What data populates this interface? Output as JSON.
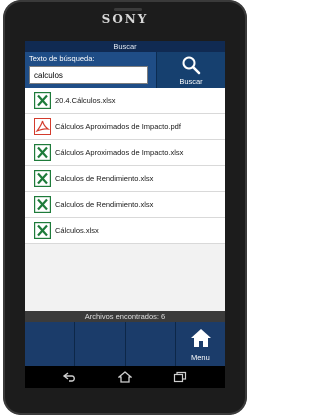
{
  "device": {
    "brand": "SONY"
  },
  "app": {
    "title": "Buscar",
    "search": {
      "label": "Texto de búsqueda:",
      "value": "calculos",
      "button_label": "Buscar"
    },
    "files": [
      {
        "name": "20.4.Cálculos.xlsx",
        "type": "excel-icon"
      },
      {
        "name": "Cálculos Aproximados de Impacto.pdf",
        "type": "pdf-icon"
      },
      {
        "name": "Cálculos Aproximados de Impacto.xlsx",
        "type": "excel-icon"
      },
      {
        "name": "Calculos de Rendimiento.xlsx",
        "type": "excel-icon"
      },
      {
        "name": "Calculos de Rendimiento.xlsx",
        "type": "excel-icon"
      },
      {
        "name": "Cálculos.xlsx",
        "type": "excel-icon"
      }
    ],
    "status": "Archivos encontrados: 6",
    "menu_label": "Menu"
  },
  "colors": {
    "header_bg": "#1f4d86",
    "title_bg": "#102a52",
    "tabbar_bg": "#1b3c6a",
    "excel_green": "#1e7b3a",
    "pdf_red": "#d33b2c"
  }
}
